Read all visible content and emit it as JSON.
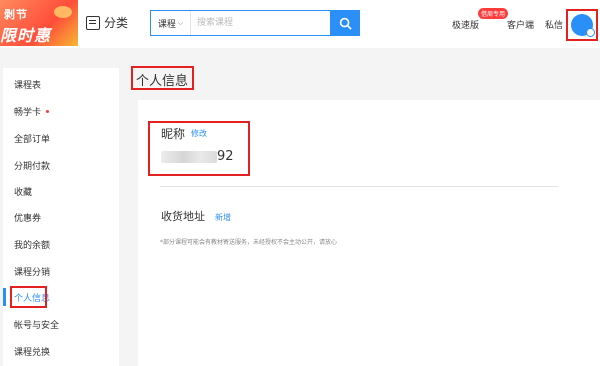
{
  "promo": {
    "line1": "剥节",
    "line2": "限时惠"
  },
  "header": {
    "category_label": "分类",
    "search": {
      "select_label": "课程",
      "placeholder": "搜索课程"
    },
    "nav": {
      "fast_label": "极速版",
      "fast_badge": "借周专用",
      "client_label": "客户端",
      "message_label": "私信"
    }
  },
  "sidebar": {
    "items": [
      {
        "label": "课程表"
      },
      {
        "label": "畅学卡"
      },
      {
        "label": "全部订单"
      },
      {
        "label": "分期付款"
      },
      {
        "label": "收藏"
      },
      {
        "label": "优惠券"
      },
      {
        "label": "我的余额"
      },
      {
        "label": "课程分销"
      },
      {
        "label": "个人信息"
      },
      {
        "label": "帐号与安全"
      },
      {
        "label": "课程兑换"
      }
    ],
    "active_index": 8
  },
  "main": {
    "page_title": "个人信息",
    "nickname": {
      "label": "昵称",
      "edit_label": "修改",
      "value_suffix": "92"
    },
    "address": {
      "label": "收货地址",
      "add_label": "新增",
      "note": "*部分课程可能会有教材寄送服务，未经授权不会主动公开，请放心"
    }
  },
  "colors": {
    "accent": "#2b8ff8",
    "highlight_box": "#e32121"
  }
}
